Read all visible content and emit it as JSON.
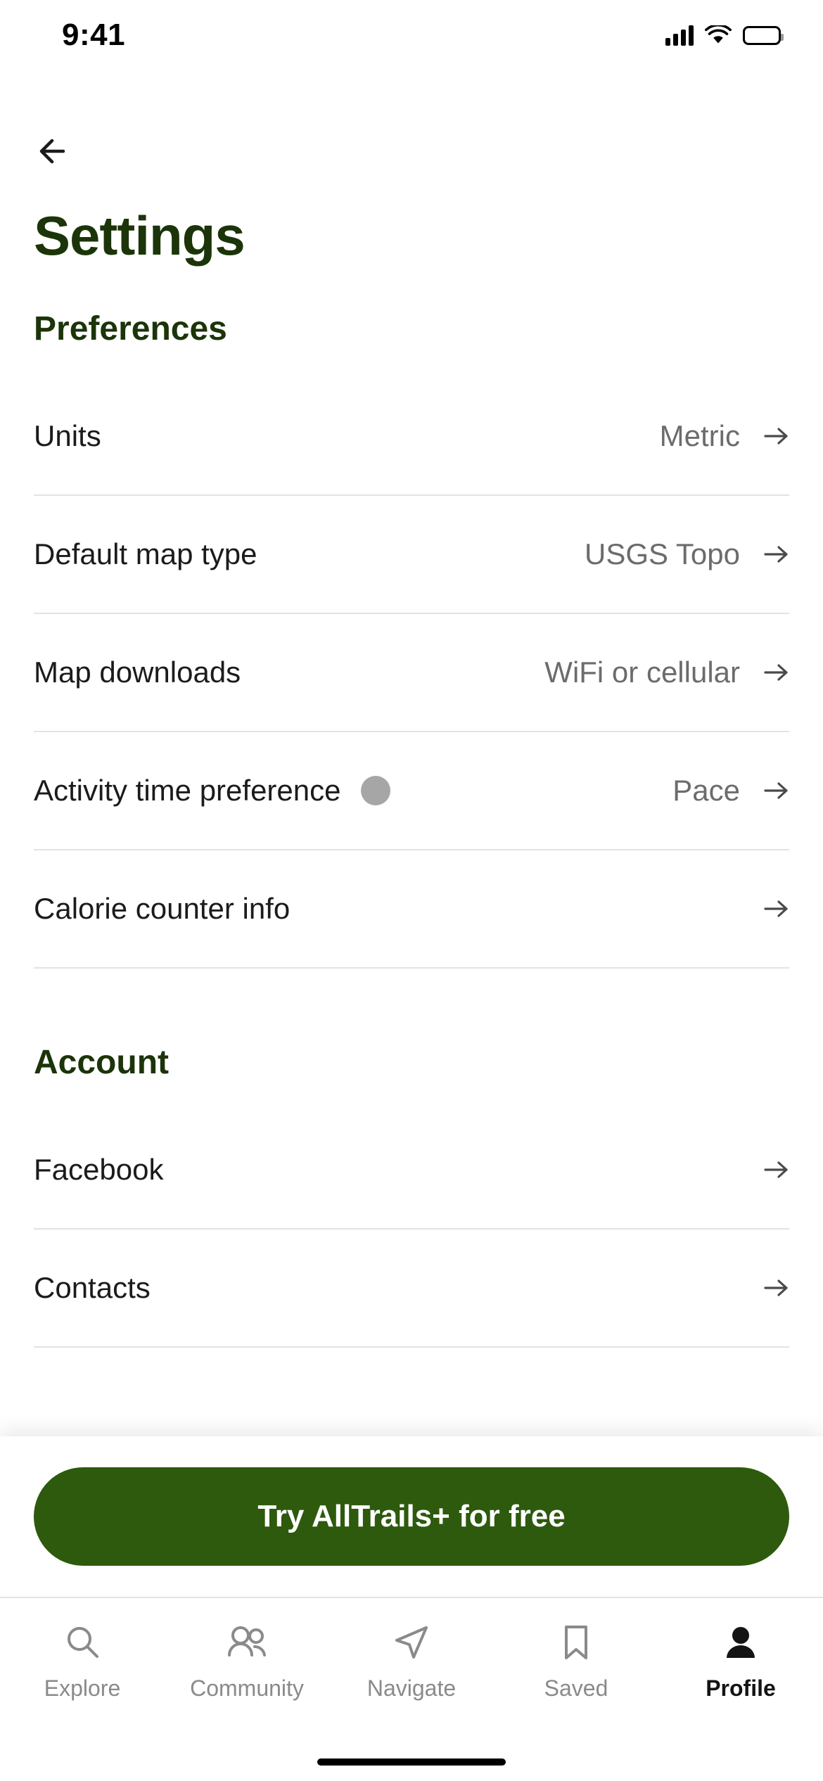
{
  "status_bar": {
    "time": "9:41",
    "signal_icon": "cellular-signal-icon",
    "wifi_icon": "wifi-icon",
    "battery_icon": "battery-full-icon"
  },
  "nav": {
    "back_icon": "back-arrow-icon",
    "title": "Settings"
  },
  "sections": [
    {
      "id": "preferences",
      "heading": "Preferences",
      "rows": [
        {
          "label": "Units",
          "value": "Metric",
          "indicator": false
        },
        {
          "label": "Default map type",
          "value": "USGS Topo",
          "indicator": false
        },
        {
          "label": "Map downloads",
          "value": "WiFi or cellular",
          "indicator": false
        },
        {
          "label": "Activity time preference",
          "value": "Pace",
          "indicator": true
        },
        {
          "label": "Calorie counter info",
          "value": "",
          "indicator": false
        }
      ]
    },
    {
      "id": "account",
      "heading": "Account",
      "rows": [
        {
          "label": "Facebook",
          "value": "",
          "indicator": false
        },
        {
          "label": "Contacts",
          "value": "",
          "indicator": false
        }
      ]
    }
  ],
  "cta": {
    "label": "Try AllTrails+ for free",
    "color": "#2d5a0d"
  },
  "tabbar": {
    "items": [
      {
        "label": "Explore",
        "icon": "search-icon",
        "active": false
      },
      {
        "label": "Community",
        "icon": "people-icon",
        "active": false
      },
      {
        "label": "Navigate",
        "icon": "navigate-arrow-icon",
        "active": false
      },
      {
        "label": "Saved",
        "icon": "bookmark-icon",
        "active": false
      },
      {
        "label": "Profile",
        "icon": "person-filled-icon",
        "active": true
      }
    ]
  },
  "colors": {
    "title": "#1b3409",
    "label": "#1b1b1b",
    "value": "#6c6c6c",
    "divider": "#e3e4e0",
    "accent": "#2d5a0d"
  }
}
